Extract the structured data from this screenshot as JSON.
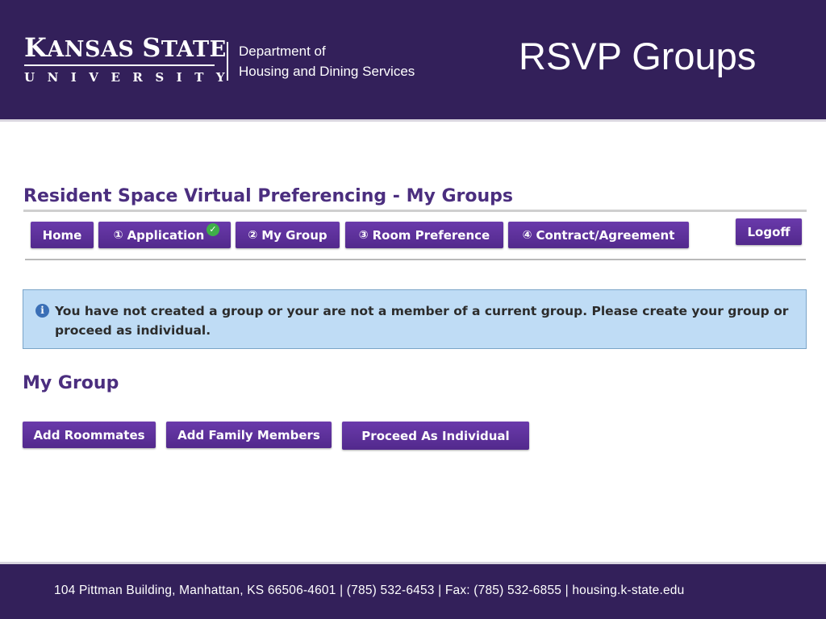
{
  "header": {
    "logo_main_k": "K",
    "logo_main_rest1": "ANSAS ",
    "logo_main_s": "S",
    "logo_main_rest2": "TATE",
    "logo_sub": "UNIVERSITY",
    "department_line1": "Department of",
    "department_line2": "Housing and Dining Services",
    "slide_title": "RSVP Groups",
    "background_color": "#33205a"
  },
  "page": {
    "heading": "Resident Space Virtual Preferencing - My Groups",
    "accent_color": "#5b2f98"
  },
  "nav": {
    "items": [
      {
        "label": "Home",
        "number": ""
      },
      {
        "label": "Application",
        "number": "①",
        "completed": true,
        "completed_icon": "check-circle-icon"
      },
      {
        "label": "My Group",
        "number": "②"
      },
      {
        "label": "Room Preference",
        "number": "③"
      },
      {
        "label": "Contract/Agreement",
        "number": "④"
      }
    ],
    "logoff_label": "Logoff"
  },
  "info": {
    "icon": "info-icon",
    "message": "You have not created a group or your are not a member of a current group. Please create your group or proceed as individual."
  },
  "my_group": {
    "heading": "My Group",
    "buttons": [
      "Add Roommates",
      "Add Family Members",
      "Proceed As Individual"
    ]
  },
  "footer": {
    "text": "104 Pittman Building, Manhattan, KS 66506-4601  |  (785) 532-6453  |  Fax: (785) 532-6855  |  housing.k-state.edu"
  }
}
